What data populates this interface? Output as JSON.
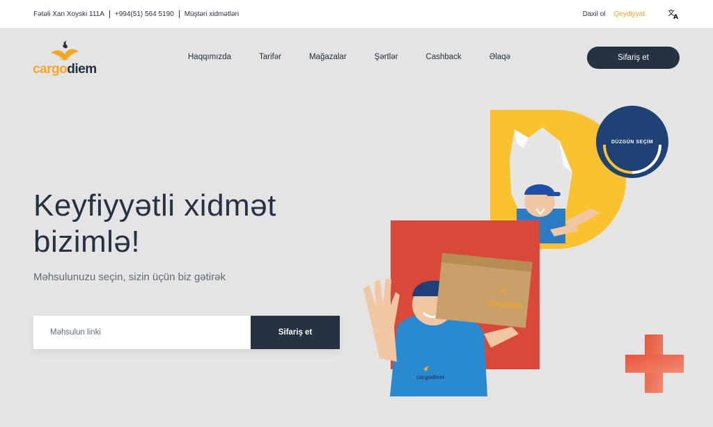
{
  "topbar": {
    "address": "Fətəli Xan Xoyski 111A",
    "phone": "+994(51) 564 5190",
    "customer_service": "Müştəri xidmətləri",
    "login": "Daxil ol",
    "register": "Qeydiyyat",
    "language_icon": "translate-icon"
  },
  "header": {
    "logo_part1": "cargo",
    "logo_part2": "diem",
    "nav": [
      "Haqqımızda",
      "Tarifər",
      "Mağazalar",
      "Şərtlər",
      "Cashback",
      "Əlaqə"
    ],
    "order_button": "Sifariş et"
  },
  "hero": {
    "title": "Keyfiyyətli xidmət bizimlə!",
    "subtitle": "Məhsulunuzu seçin, sizin üçün biz gətirək",
    "input_placeholder": "Məhsulun linki",
    "submit_button": "Sifariş et"
  },
  "illustration": {
    "badge_text": "DÜZGÜN SEÇİM",
    "box_brand": "cargodiem",
    "shirt_brand": "cargodiem"
  },
  "colors": {
    "primary_dark": "#243242",
    "accent_orange": "#f5a623",
    "yellow": "#f9c22e",
    "red": "#d94838",
    "badge_blue": "#1e4275",
    "background": "#e4e4e4"
  }
}
